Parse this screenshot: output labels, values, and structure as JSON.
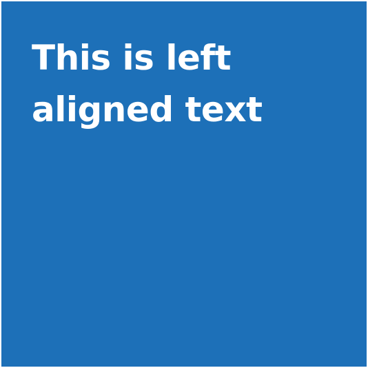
{
  "tile": {
    "background_color": "#1d70b8",
    "text_color": "#ffffff",
    "heading": "This is left aligned text"
  }
}
